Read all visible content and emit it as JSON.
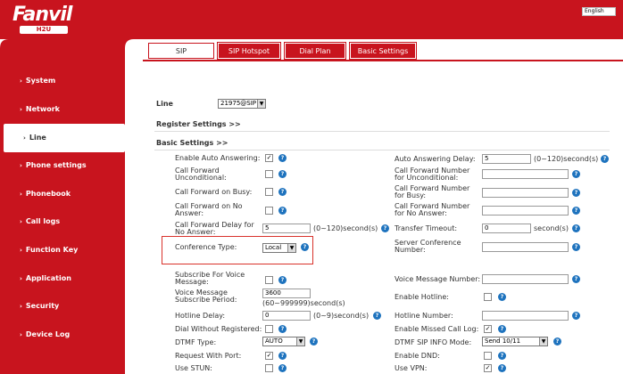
{
  "brand": {
    "name": "Fanvil",
    "model": "H2U"
  },
  "language": "English",
  "sidebar": {
    "items": [
      {
        "label": "System"
      },
      {
        "label": "Network"
      },
      {
        "label": "Line"
      },
      {
        "label": "Phone settings"
      },
      {
        "label": "Phonebook"
      },
      {
        "label": "Call logs"
      },
      {
        "label": "Function Key"
      },
      {
        "label": "Application"
      },
      {
        "label": "Security"
      },
      {
        "label": "Device Log"
      }
    ]
  },
  "tabs": [
    {
      "label": "SIP"
    },
    {
      "label": "SIP Hotspot"
    },
    {
      "label": "Dial Plan"
    },
    {
      "label": "Basic Settings"
    }
  ],
  "line": {
    "label": "Line",
    "value": "21975@SIP"
  },
  "sections": {
    "register": "Register Settings >>",
    "basic": "Basic Settings >>"
  },
  "left": {
    "auto_answer": "Enable Auto Answering:",
    "cfu": "Call Forward Unconditional:",
    "cfb": "Call Forward on Busy:",
    "cfna": "Call Forward on No Answer:",
    "cfd": "Call Forward Delay for No Answer:",
    "cfd_val": "5",
    "cfd_unit": "(0~120)second(s)",
    "conf": "Conference Type:",
    "conf_val": "Local",
    "vm_sub": "Subscribe For Voice Message:",
    "vm_period": "Voice Message Subscribe Period:",
    "vm_period_val": "3600",
    "vm_period_unit": "(60~999999)second(s)",
    "hotline_delay": "Hotline Delay:",
    "hotline_delay_val": "0",
    "hotline_delay_unit": "(0~9)second(s)",
    "dial_wo_reg": "Dial Without Registered:",
    "dtmf": "DTMF Type:",
    "dtmf_val": "AUTO",
    "req_port": "Request With Port:",
    "stun": "Use STUN:"
  },
  "right": {
    "aa_delay": "Auto Answering Delay:",
    "aa_delay_val": "5",
    "aa_delay_unit": "(0~120)second(s)",
    "cfu_num": "Call Forward Number for Unconditional:",
    "cfb_num": "Call Forward Number for Busy:",
    "cfna_num": "Call Forward Number for No Answer:",
    "transfer": "Transfer Timeout:",
    "transfer_val": "0",
    "transfer_unit": "second(s)",
    "conf_num": "Server Conference Number:",
    "vm_num": "Voice Message Number:",
    "hotline": "Enable Hotline:",
    "hotline_num": "Hotline Number:",
    "missed": "Enable Missed Call Log:",
    "dtmf_info": "DTMF SIP INFO Mode:",
    "dtmf_info_val": "Send 10/11",
    "dnd": "Enable DND:",
    "vpn": "Use VPN:"
  },
  "checks": {
    "auto_answer": true,
    "missed": true,
    "req_port": true,
    "vpn": true
  },
  "icons": {
    "help": "help-icon",
    "dropdown": "dropdown-arrow-icon",
    "check": "checkmark-icon"
  },
  "colors": {
    "brand_red": "#c8141e",
    "help_blue": "#1e73be",
    "highlight": "#d9322b"
  }
}
